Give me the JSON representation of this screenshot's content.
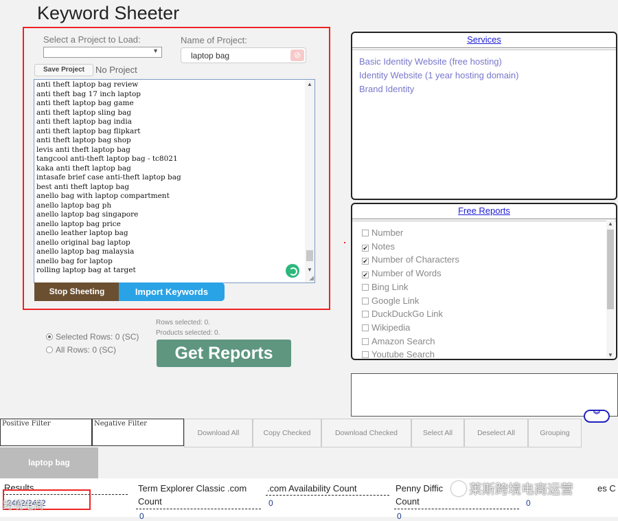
{
  "app_title": "Keyword Sheeter",
  "project": {
    "select_label": "Select a Project to Load:",
    "select_value": "",
    "name_label": "Name of Project:",
    "name_value": "laptop bag",
    "save_label": "Save Project",
    "status": "No Project"
  },
  "keywords": [
    "anti theft laptop bag review",
    "anti theft bag 17 inch laptop",
    "anti theft laptop bag game",
    "anti theft laptop sling bag",
    "anti theft laptop bag india",
    "anti theft laptop bag flipkart",
    "anti theft laptop bag shop",
    "levis anti theft laptop bag",
    "tangcool anti-theft laptop bag - tc8021",
    "kaka anti theft laptop bag",
    "intasafe brief case anti-theft laptop bag",
    "best anti theft laptop bag",
    "anello bag with laptop compartment",
    "anello laptop bag ph",
    "anello laptop bag singapore",
    "anello laptop bag price",
    "anello leather laptop bag",
    "anello original bag laptop",
    "anello laptop bag malaysia",
    "anello bag for laptop",
    "rolling laptop bag at target"
  ],
  "buttons": {
    "stop_sheeting": "Stop Sheeting",
    "import_keywords": "Import Keywords",
    "get_reports": "Get Reports"
  },
  "selection": {
    "selected_rows": "Selected Rows: 0 (SC)",
    "all_rows": "All Rows: 0 (SC)",
    "rows_selected": "Rows selected: 0.",
    "products_selected": "Products selected: 0."
  },
  "services": {
    "title": "Services",
    "items": [
      "Basic Identity Website (free hosting)",
      "Identity Website (1 year hosting domain)",
      "Brand Identity"
    ]
  },
  "free_reports": {
    "title": "Free Reports",
    "items": [
      {
        "label": "Number",
        "checked": false
      },
      {
        "label": "Notes",
        "checked": true
      },
      {
        "label": "Number of Characters",
        "checked": true
      },
      {
        "label": "Number of Words",
        "checked": true
      },
      {
        "label": "Bing Link",
        "checked": false
      },
      {
        "label": "Google Link",
        "checked": false
      },
      {
        "label": "DuckDuckGo Link",
        "checked": false
      },
      {
        "label": "Wikipedia",
        "checked": false
      },
      {
        "label": "Amazon Search",
        "checked": false
      },
      {
        "label": "Youtube Search",
        "checked": false
      }
    ]
  },
  "toolbar": {
    "positive_filter": "Positive Filter",
    "negative_filter": "Negative Filter",
    "download_all": "Download All",
    "copy_checked": "Copy Checked",
    "download_checked": "Download Checked",
    "select_all": "Select All",
    "deselect_all": "Deselect All",
    "grouping": "Grouping"
  },
  "tabs": [
    "laptop bag"
  ],
  "table": {
    "results_label": "Results",
    "results_value": "2462/2462",
    "col1_head": "Term Explorer Classic .com",
    "col1_sub": "Count",
    "col1_value": "0",
    "col2_head": ".com Availability Count",
    "col2_value": "0",
    "col3_head": "Penny Diffic",
    "col3_sub": "Count",
    "col3_value": "0",
    "col4_value": "0",
    "col5_head": "es C"
  },
  "watermark": "莱斯跨境电商运营",
  "watermark2": "跨境电商"
}
